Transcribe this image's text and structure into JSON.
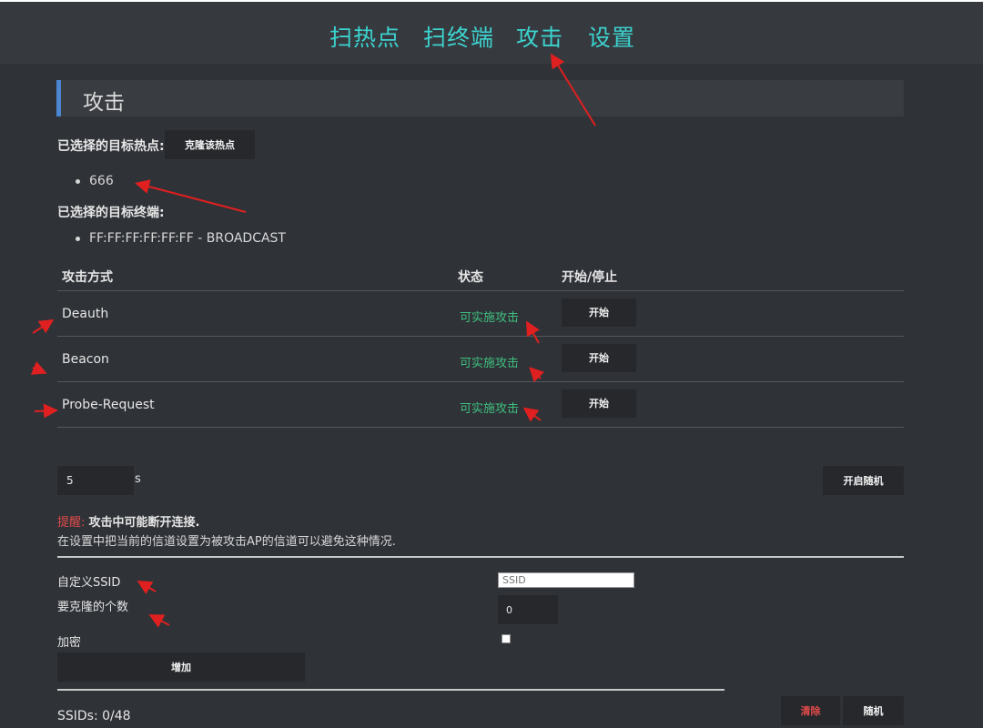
{
  "nav": {
    "items": [
      "扫热点",
      "扫终端",
      "攻击",
      "设置"
    ]
  },
  "section": {
    "title": "攻击"
  },
  "target_ap": {
    "label": "已选择的目标热点:",
    "clone_button": "克隆该热点",
    "items": [
      "666"
    ]
  },
  "target_station": {
    "label": "已选择的目标终端:",
    "items": [
      "FF:FF:FF:FF:FF:FF - BROADCAST"
    ]
  },
  "attack_table": {
    "headers": [
      "攻击方式",
      "状态",
      "开始/停止"
    ],
    "rows": [
      {
        "name": "Deauth",
        "status": "可实施攻击",
        "action": "开始"
      },
      {
        "name": "Beacon",
        "status": "可实施攻击",
        "action": "开始"
      },
      {
        "name": "Probe-Request",
        "status": "可实施攻击",
        "action": "开始"
      }
    ]
  },
  "timer": {
    "value": "5",
    "unit": "s",
    "random_button": "开启随机"
  },
  "warning": {
    "prefix": "提醒:",
    "bold": "攻击中可能断开连接.",
    "line2": "在设置中把当前的信道设置为被攻击AP的信道可以避免这种情况."
  },
  "ssid_form": {
    "custom_ssid_label": "自定义SSID",
    "ssid_placeholder": "SSID",
    "clone_count_label": "要克隆的个数",
    "clone_count_value": "0",
    "encrypt_label": "加密",
    "add_button": "增加"
  },
  "ssid_list": {
    "count": "SSIDs: 0/48",
    "clear_button": "清除",
    "random_button": "随机"
  },
  "colors": {
    "background": "#2f3237",
    "nav_text": "#3cd3cf",
    "accent_bar": "#4b86d1",
    "status_ok": "#3fbf7f",
    "warning": "#e14b4b",
    "annotation_arrow": "#e02020"
  }
}
